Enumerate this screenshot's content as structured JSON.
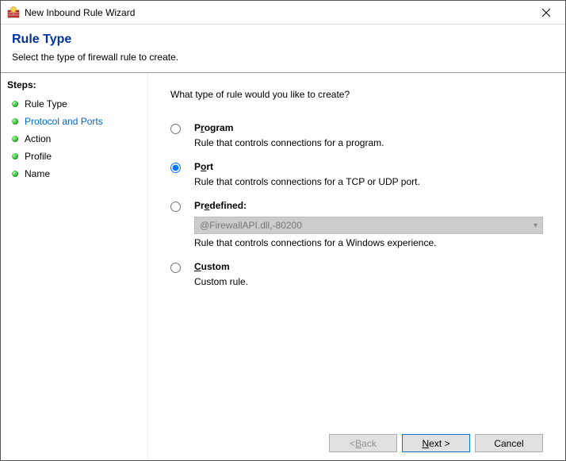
{
  "titlebar": {
    "title": "New Inbound Rule Wizard"
  },
  "header": {
    "title": "Rule Type",
    "subtitle": "Select the type of firewall rule to create."
  },
  "sidebar": {
    "heading": "Steps:",
    "items": [
      {
        "label": "Rule Type",
        "link": false
      },
      {
        "label": "Protocol and Ports",
        "link": true
      },
      {
        "label": "Action",
        "link": false
      },
      {
        "label": "Profile",
        "link": false
      },
      {
        "label": "Name",
        "link": false
      }
    ]
  },
  "main": {
    "prompt": "What type of rule would you like to create?",
    "options": {
      "program": {
        "label_pre": "P",
        "label_ul": "r",
        "label_post": "ogram",
        "desc": "Rule that controls connections for a program."
      },
      "port": {
        "label_pre": "P",
        "label_ul": "o",
        "label_post": "rt",
        "desc": "Rule that controls connections for a TCP or UDP port."
      },
      "predefined": {
        "label_pre": "Pr",
        "label_ul": "e",
        "label_post": "defined:",
        "select_value": "@FirewallAPI.dll,-80200",
        "desc": "Rule that controls connections for a Windows experience."
      },
      "custom": {
        "label_pre": "",
        "label_ul": "C",
        "label_post": "ustom",
        "desc": "Custom rule."
      }
    },
    "selected": "port"
  },
  "footer": {
    "back_pre": "< ",
    "back_ul": "B",
    "back_post": "ack",
    "next_pre": "",
    "next_ul": "N",
    "next_post": "ext >",
    "cancel": "Cancel"
  }
}
